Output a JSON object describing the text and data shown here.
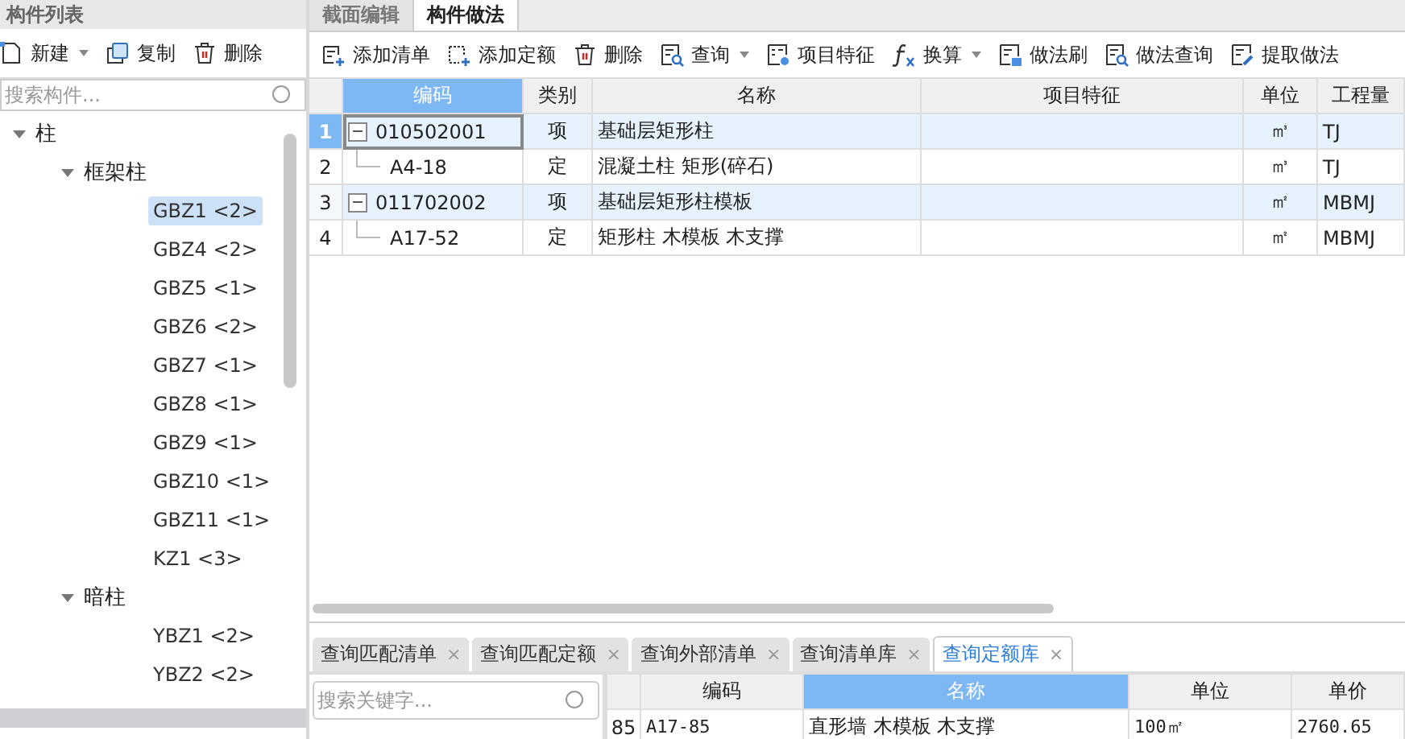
{
  "left_panel": {
    "title": "构件列表",
    "toolbar": [
      {
        "label": "新建",
        "dropdown": true
      },
      {
        "label": "复制",
        "dropdown": false
      },
      {
        "label": "删除",
        "dropdown": false
      }
    ],
    "search": {
      "placeholder": "搜索构件..."
    },
    "tree": [
      {
        "label": "柱",
        "expanded": true,
        "children": [
          {
            "label": "框架柱",
            "expanded": true,
            "children": [
              {
                "label": "GBZ1 <2>",
                "selected": true
              },
              {
                "label": "GBZ4 <2>",
                "selected": false
              },
              {
                "label": "GBZ5 <1>",
                "selected": false
              },
              {
                "label": "GBZ6 <2>",
                "selected": false
              },
              {
                "label": "GBZ7 <1>",
                "selected": false
              },
              {
                "label": "GBZ8 <1>",
                "selected": false
              },
              {
                "label": "GBZ9 <1>",
                "selected": false
              },
              {
                "label": "GBZ10 <1>",
                "selected": false
              },
              {
                "label": "GBZ11 <1>",
                "selected": false
              },
              {
                "label": "KZ1 <3>",
                "selected": false
              }
            ]
          },
          {
            "label": "暗柱",
            "expanded": true,
            "children": [
              {
                "label": "YBZ1 <2>",
                "selected": false
              },
              {
                "label": "YBZ2 <2>",
                "selected": false
              }
            ]
          }
        ]
      }
    ]
  },
  "main_tabs": [
    {
      "label": "截面编辑",
      "selected": false
    },
    {
      "label": "构件做法",
      "selected": true
    }
  ],
  "toolbar": [
    {
      "label": "添加清单",
      "dropdown": false
    },
    {
      "label": "添加定额",
      "dropdown": false
    },
    {
      "label": "删除",
      "dropdown": false
    },
    {
      "label": "查询",
      "dropdown": true
    },
    {
      "label": "项目特征",
      "dropdown": false
    },
    {
      "label": "换算",
      "dropdown": true
    },
    {
      "label": "做法刷",
      "dropdown": false
    },
    {
      "label": "做法查询",
      "dropdown": false
    },
    {
      "label": "提取做法",
      "dropdown": false
    }
  ],
  "table": {
    "columns": [
      {
        "label": "编码",
        "selected": true
      },
      {
        "label": "类别",
        "selected": false
      },
      {
        "label": "名称",
        "selected": false
      },
      {
        "label": "项目特征",
        "selected": false
      },
      {
        "label": "单位",
        "selected": false
      },
      {
        "label": "工程量",
        "selected": false
      }
    ],
    "rows": [
      {
        "number": "1",
        "kind": "item",
        "selected": true,
        "code": "010502001",
        "category": "项",
        "name": "基础层矩形柱",
        "unit": "㎥",
        "expression": "TJ"
      },
      {
        "number": "2",
        "kind": "quota",
        "selected": false,
        "code": "A4-18",
        "category": "定",
        "name": "混凝土柱 矩形(碎石)",
        "unit": "㎥",
        "expression": "TJ"
      },
      {
        "number": "3",
        "kind": "item",
        "selected": false,
        "code": "011702002",
        "category": "项",
        "name": "基础层矩形柱模板",
        "unit": "㎡",
        "expression": "MBMJ"
      },
      {
        "number": "4",
        "kind": "quota",
        "selected": false,
        "code": "A17-52",
        "category": "定",
        "name": "矩形柱 木模板 木支撑",
        "unit": "㎡",
        "expression": "MBMJ"
      }
    ]
  },
  "bottom_tabs": [
    {
      "label": "查询匹配清单",
      "selected": false,
      "close": "×"
    },
    {
      "label": "查询匹配定额",
      "selected": false,
      "close": "×"
    },
    {
      "label": "查询外部清单",
      "selected": false,
      "close": "×"
    },
    {
      "label": "查询清单库",
      "selected": false,
      "close": "×"
    },
    {
      "label": "查询定额库",
      "selected": true,
      "close": "×"
    }
  ],
  "bottom_search": {
    "placeholder": "搜索关键字..."
  },
  "bottom_table": {
    "columns": [
      {
        "label": "编码",
        "selected": false
      },
      {
        "label": "名称",
        "selected": true
      },
      {
        "label": "单位",
        "selected": false
      },
      {
        "label": "单价",
        "selected": false
      }
    ],
    "rows": [
      {
        "number": "85",
        "code": "A17-85",
        "name": "直形墙 木模板 木支撑",
        "unit": "100㎡",
        "price": "2760.65"
      }
    ]
  }
}
